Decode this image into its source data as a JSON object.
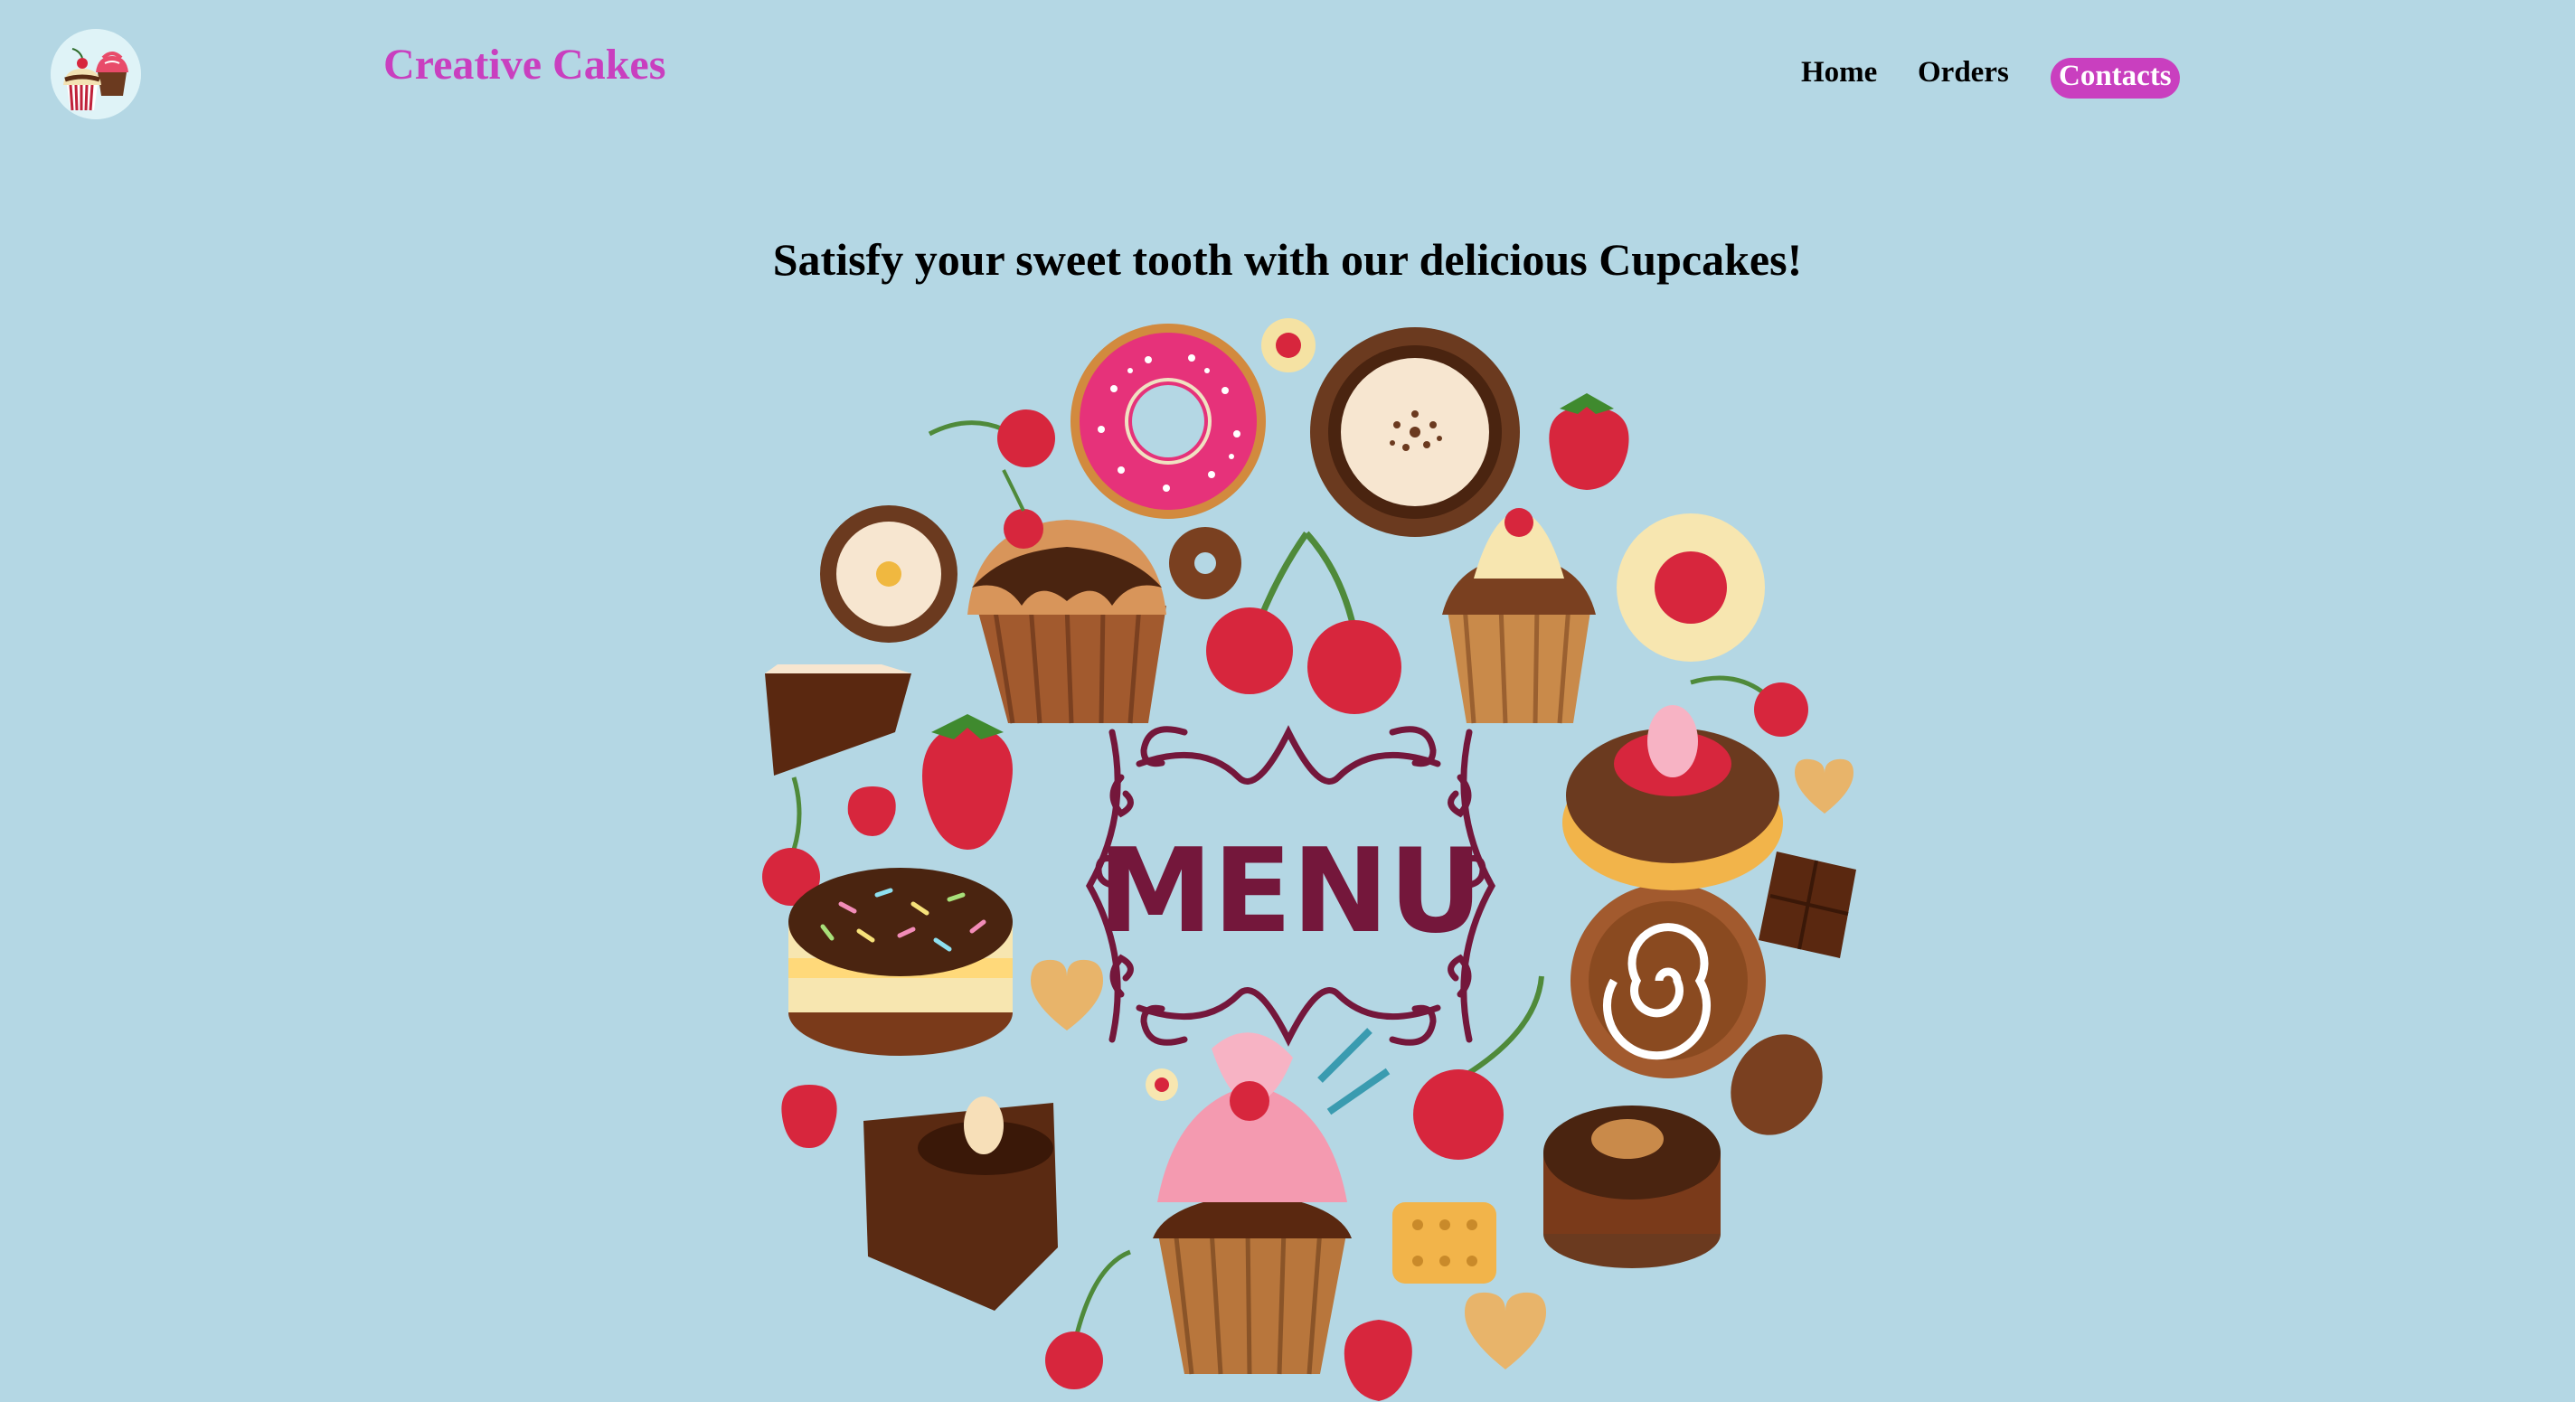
{
  "header": {
    "logo_icon": "cupcakes-logo-icon",
    "brand_title": "Creative Cakes",
    "brand_color": "#c93fbf"
  },
  "nav": {
    "items": [
      {
        "label": "Home"
      },
      {
        "label": "Orders"
      },
      {
        "label": "Contacts",
        "active": true
      }
    ],
    "active_color": "#c93fbf"
  },
  "hero": {
    "tagline": "Satisfy your sweet tooth with our delicious Cupcakes!",
    "menu_label": "MENU",
    "menu_color": "#74173b",
    "illustration": "desserts-menu-illustration"
  },
  "colors": {
    "background": "#b4d7e4"
  }
}
